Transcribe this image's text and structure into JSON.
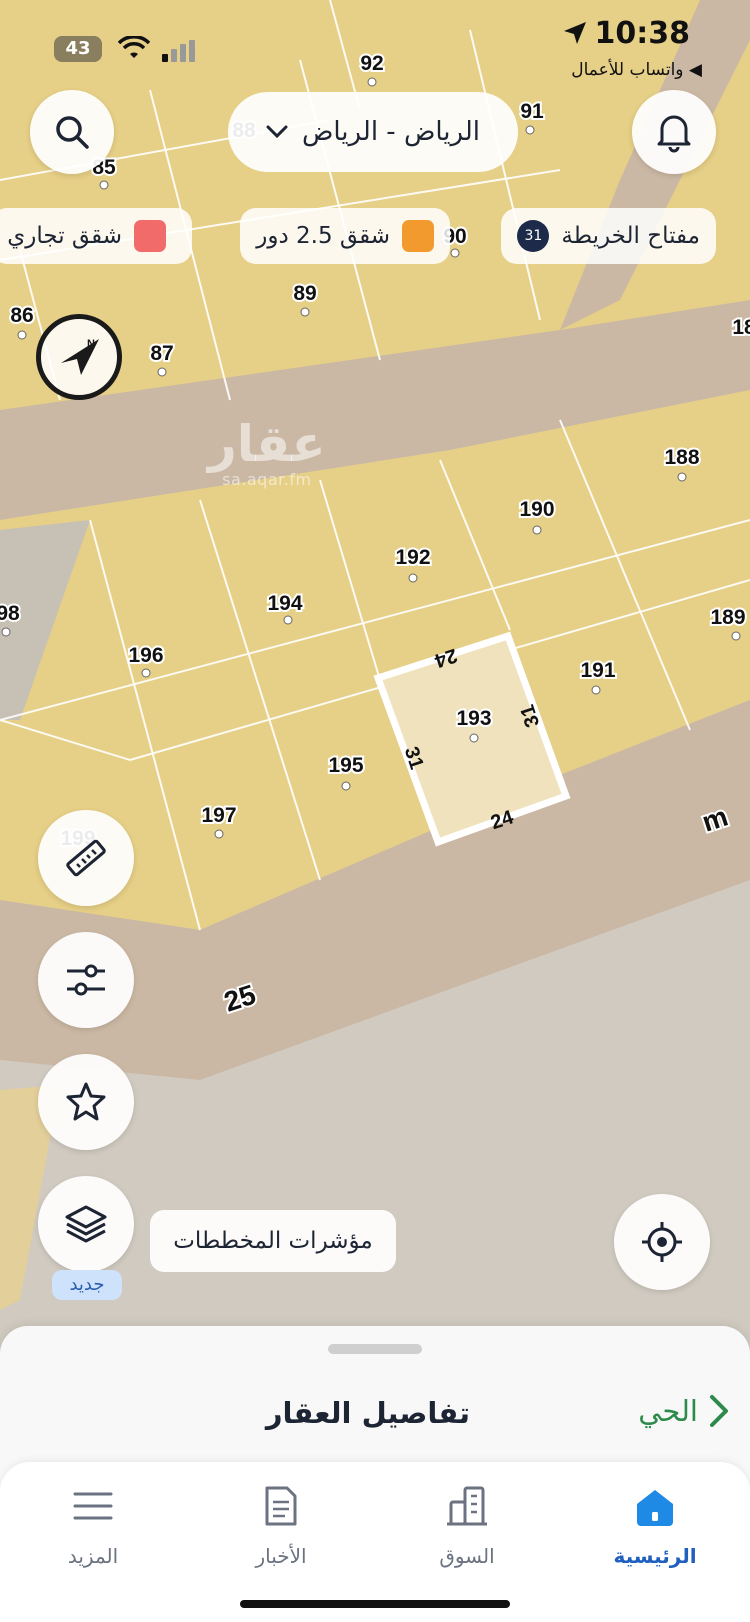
{
  "status_bar": {
    "time": "10:38",
    "back_app": "◀ واتساب للأعمال",
    "battery": "43"
  },
  "map": {
    "plots": [
      {
        "id": "85"
      },
      {
        "id": "86"
      },
      {
        "id": "87"
      },
      {
        "id": "88"
      },
      {
        "id": "89"
      },
      {
        "id": "90"
      },
      {
        "id": "91"
      },
      {
        "id": "92"
      },
      {
        "id": "188"
      },
      {
        "id": "189"
      },
      {
        "id": "190"
      },
      {
        "id": "191"
      },
      {
        "id": "192"
      },
      {
        "id": "193"
      },
      {
        "id": "194"
      },
      {
        "id": "195"
      },
      {
        "id": "196"
      },
      {
        "id": "197"
      },
      {
        "id": "98"
      },
      {
        "id": "199"
      },
      {
        "id": "18"
      }
    ],
    "dimensions": {
      "top": "24",
      "bottom": "24",
      "left": "31",
      "right": "31"
    },
    "street_width": "25",
    "street_unit": "m",
    "watermark": {
      "name": "عقار",
      "url": "sa.aqar.fm"
    }
  },
  "header": {
    "city": "الرياض - الرياض"
  },
  "legend": {
    "key_label": "مفتاح الخريطة",
    "key_count": "31",
    "items": [
      {
        "label": "شقق 2.5 دور",
        "color": "#f39a2e"
      },
      {
        "label": "شقق تجاري",
        "color": "#f26b6b"
      }
    ]
  },
  "controls": {
    "indicators_label": "مؤشرات المخططات",
    "new_badge": "جديد"
  },
  "sheet": {
    "title": "تفاصيل العقار",
    "district_link": "الحي"
  },
  "tabs": [
    {
      "label": "الرئيسية",
      "icon": "home-icon",
      "active": true
    },
    {
      "label": "السوق",
      "icon": "buildings-icon",
      "active": false
    },
    {
      "label": "الأخبار",
      "icon": "news-icon",
      "active": false
    },
    {
      "label": "المزيد",
      "icon": "menu-icon",
      "active": false
    }
  ],
  "colors": {
    "plot_fill": "#e6cf86",
    "road": "#cbb8a4",
    "selected_plot": "#efe2bd",
    "accent_blue": "#1f5fbf",
    "accent_green": "#2e8a4a"
  }
}
